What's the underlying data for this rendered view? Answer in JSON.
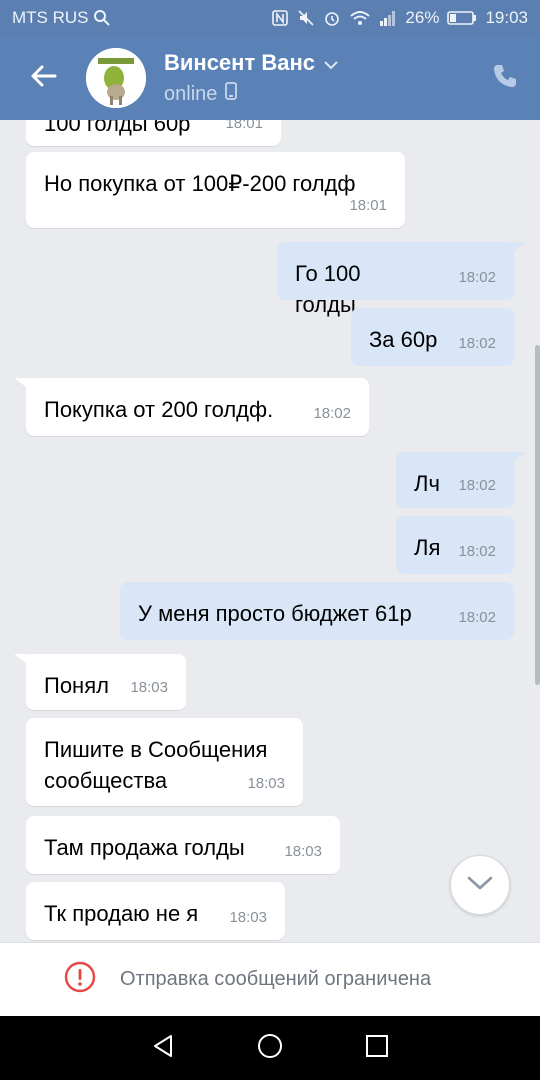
{
  "status_bar": {
    "carrier": "MTS RUS",
    "battery": "26%",
    "time": "19:03",
    "icons": [
      "search-icon",
      "nfc-icon",
      "mute-icon",
      "alarm-icon",
      "wifi-icon",
      "signal-icon",
      "battery-icon"
    ]
  },
  "header": {
    "contact_name": "Винсент Ванс",
    "presence": "online",
    "back_icon": "arrow-left-icon",
    "call_icon": "phone-icon",
    "accent_color": "#5b82b7"
  },
  "messages": [
    {
      "direction": "in",
      "text": "100 голды 60р",
      "time": "18:01"
    },
    {
      "direction": "in",
      "text": "Но покупка от 100₽-200 голдф",
      "time": "18:01"
    },
    {
      "direction": "out",
      "text": "Го 100 голды",
      "time": "18:02"
    },
    {
      "direction": "out",
      "text": "За 60р",
      "time": "18:02"
    },
    {
      "direction": "in",
      "text": "Покупка от 200 голдф.",
      "time": "18:02"
    },
    {
      "direction": "out",
      "text": "Лч",
      "time": "18:02"
    },
    {
      "direction": "out",
      "text": "Ля",
      "time": "18:02"
    },
    {
      "direction": "out",
      "text": "У меня просто бюджет 61р",
      "time": "18:02"
    },
    {
      "direction": "in",
      "text": "Понял",
      "time": "18:03"
    },
    {
      "direction": "in",
      "text": "Пишите в Сообщения сообщества",
      "text_line1": "Пишите в Сообщения",
      "text_line2": "сообщества",
      "time": "18:03"
    },
    {
      "direction": "in",
      "text": "Там продажа голды",
      "time": "18:03"
    },
    {
      "direction": "in",
      "text": "Тк продаю не я",
      "time": "18:03"
    }
  ],
  "restricted_bar": {
    "text": "Отправка сообщений ограничена",
    "icon": "alert-circle-icon",
    "icon_color": "#e64646"
  },
  "nav_bar": {
    "icons": [
      "nav-back-icon",
      "nav-home-icon",
      "nav-recents-icon"
    ]
  }
}
